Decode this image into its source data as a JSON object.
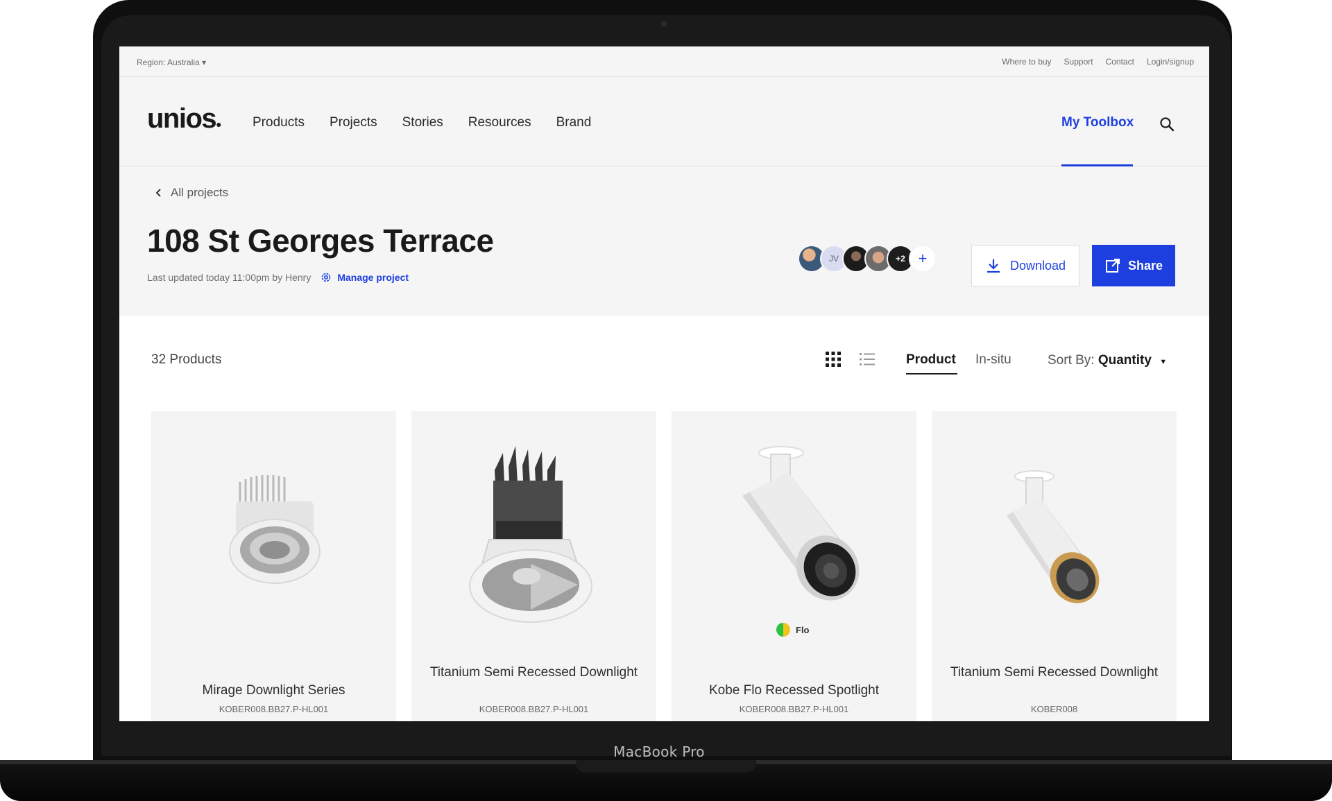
{
  "device": {
    "label": "MacBook Pro"
  },
  "utility": {
    "region_label": "Region:",
    "region_value": "Australia",
    "links": [
      "Where to buy",
      "Support",
      "Contact",
      "Login/signup"
    ]
  },
  "nav": {
    "logo": "unios",
    "items": [
      "Products",
      "Projects",
      "Stories",
      "Resources",
      "Brand"
    ],
    "toolbox": "My Toolbox"
  },
  "project": {
    "back_label": "All projects",
    "title": "108 St Georges Terrace",
    "updated": "Last updated today 11:00pm by Henry",
    "manage_label": "Manage project",
    "avatars": [
      "JV",
      "+2"
    ],
    "add_label": "+",
    "download_label": "Download",
    "share_label": "Share"
  },
  "listing": {
    "count": "32 Products",
    "tab_product": "Product",
    "tab_insitu": "In-situ",
    "sort_label": "Sort By:",
    "sort_value": "Quantity"
  },
  "products": [
    {
      "name": "Mirage Downlight Series",
      "sku": "KOBER008.BB27.P-HL001"
    },
    {
      "name": "Titanium Semi Recessed Downlight",
      "sku": "KOBER008.BB27.P-HL001"
    },
    {
      "name": "Kobe Flo Recessed Spotlight",
      "sku": "KOBER008.BB27.P-HL001",
      "badge": "Flo"
    },
    {
      "name": "Titanium Semi Recessed Downlight",
      "sku": "KOBER008"
    }
  ],
  "colors": {
    "accent": "#1d3fe0",
    "page_bg": "#f5f5f5",
    "card_bg": "#f4f4f4"
  },
  "icons": [
    "chevron-left-icon",
    "search-icon",
    "gear-icon",
    "download-icon",
    "share-icon",
    "grid-view-icon",
    "list-view-icon",
    "caret-down-icon"
  ]
}
